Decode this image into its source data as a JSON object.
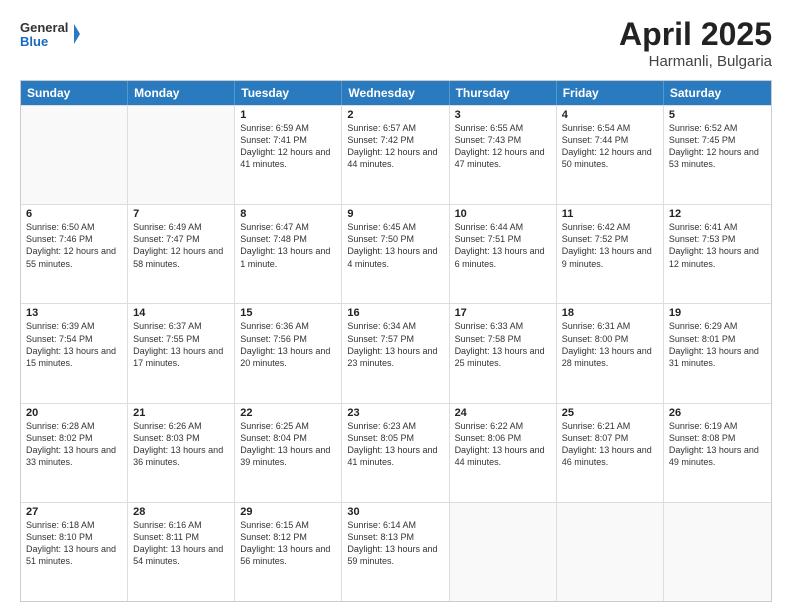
{
  "header": {
    "logo_general": "General",
    "logo_blue": "Blue",
    "title": "April 2025",
    "location": "Harmanli, Bulgaria"
  },
  "weekdays": [
    "Sunday",
    "Monday",
    "Tuesday",
    "Wednesday",
    "Thursday",
    "Friday",
    "Saturday"
  ],
  "rows": [
    [
      {
        "day": "",
        "text": ""
      },
      {
        "day": "",
        "text": ""
      },
      {
        "day": "1",
        "text": "Sunrise: 6:59 AM\nSunset: 7:41 PM\nDaylight: 12 hours and 41 minutes."
      },
      {
        "day": "2",
        "text": "Sunrise: 6:57 AM\nSunset: 7:42 PM\nDaylight: 12 hours and 44 minutes."
      },
      {
        "day": "3",
        "text": "Sunrise: 6:55 AM\nSunset: 7:43 PM\nDaylight: 12 hours and 47 minutes."
      },
      {
        "day": "4",
        "text": "Sunrise: 6:54 AM\nSunset: 7:44 PM\nDaylight: 12 hours and 50 minutes."
      },
      {
        "day": "5",
        "text": "Sunrise: 6:52 AM\nSunset: 7:45 PM\nDaylight: 12 hours and 53 minutes."
      }
    ],
    [
      {
        "day": "6",
        "text": "Sunrise: 6:50 AM\nSunset: 7:46 PM\nDaylight: 12 hours and 55 minutes."
      },
      {
        "day": "7",
        "text": "Sunrise: 6:49 AM\nSunset: 7:47 PM\nDaylight: 12 hours and 58 minutes."
      },
      {
        "day": "8",
        "text": "Sunrise: 6:47 AM\nSunset: 7:48 PM\nDaylight: 13 hours and 1 minute."
      },
      {
        "day": "9",
        "text": "Sunrise: 6:45 AM\nSunset: 7:50 PM\nDaylight: 13 hours and 4 minutes."
      },
      {
        "day": "10",
        "text": "Sunrise: 6:44 AM\nSunset: 7:51 PM\nDaylight: 13 hours and 6 minutes."
      },
      {
        "day": "11",
        "text": "Sunrise: 6:42 AM\nSunset: 7:52 PM\nDaylight: 13 hours and 9 minutes."
      },
      {
        "day": "12",
        "text": "Sunrise: 6:41 AM\nSunset: 7:53 PM\nDaylight: 13 hours and 12 minutes."
      }
    ],
    [
      {
        "day": "13",
        "text": "Sunrise: 6:39 AM\nSunset: 7:54 PM\nDaylight: 13 hours and 15 minutes."
      },
      {
        "day": "14",
        "text": "Sunrise: 6:37 AM\nSunset: 7:55 PM\nDaylight: 13 hours and 17 minutes."
      },
      {
        "day": "15",
        "text": "Sunrise: 6:36 AM\nSunset: 7:56 PM\nDaylight: 13 hours and 20 minutes."
      },
      {
        "day": "16",
        "text": "Sunrise: 6:34 AM\nSunset: 7:57 PM\nDaylight: 13 hours and 23 minutes."
      },
      {
        "day": "17",
        "text": "Sunrise: 6:33 AM\nSunset: 7:58 PM\nDaylight: 13 hours and 25 minutes."
      },
      {
        "day": "18",
        "text": "Sunrise: 6:31 AM\nSunset: 8:00 PM\nDaylight: 13 hours and 28 minutes."
      },
      {
        "day": "19",
        "text": "Sunrise: 6:29 AM\nSunset: 8:01 PM\nDaylight: 13 hours and 31 minutes."
      }
    ],
    [
      {
        "day": "20",
        "text": "Sunrise: 6:28 AM\nSunset: 8:02 PM\nDaylight: 13 hours and 33 minutes."
      },
      {
        "day": "21",
        "text": "Sunrise: 6:26 AM\nSunset: 8:03 PM\nDaylight: 13 hours and 36 minutes."
      },
      {
        "day": "22",
        "text": "Sunrise: 6:25 AM\nSunset: 8:04 PM\nDaylight: 13 hours and 39 minutes."
      },
      {
        "day": "23",
        "text": "Sunrise: 6:23 AM\nSunset: 8:05 PM\nDaylight: 13 hours and 41 minutes."
      },
      {
        "day": "24",
        "text": "Sunrise: 6:22 AM\nSunset: 8:06 PM\nDaylight: 13 hours and 44 minutes."
      },
      {
        "day": "25",
        "text": "Sunrise: 6:21 AM\nSunset: 8:07 PM\nDaylight: 13 hours and 46 minutes."
      },
      {
        "day": "26",
        "text": "Sunrise: 6:19 AM\nSunset: 8:08 PM\nDaylight: 13 hours and 49 minutes."
      }
    ],
    [
      {
        "day": "27",
        "text": "Sunrise: 6:18 AM\nSunset: 8:10 PM\nDaylight: 13 hours and 51 minutes."
      },
      {
        "day": "28",
        "text": "Sunrise: 6:16 AM\nSunset: 8:11 PM\nDaylight: 13 hours and 54 minutes."
      },
      {
        "day": "29",
        "text": "Sunrise: 6:15 AM\nSunset: 8:12 PM\nDaylight: 13 hours and 56 minutes."
      },
      {
        "day": "30",
        "text": "Sunrise: 6:14 AM\nSunset: 8:13 PM\nDaylight: 13 hours and 59 minutes."
      },
      {
        "day": "",
        "text": ""
      },
      {
        "day": "",
        "text": ""
      },
      {
        "day": "",
        "text": ""
      }
    ]
  ]
}
